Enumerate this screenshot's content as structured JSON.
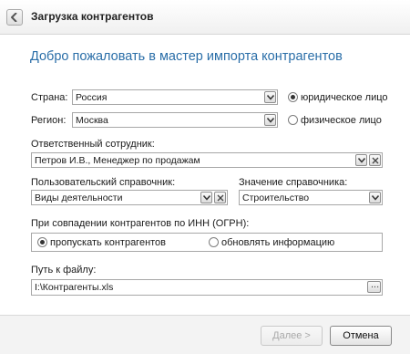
{
  "header": {
    "title": "Загрузка контрагентов",
    "back_icon": "chevron-left-icon"
  },
  "welcome": "Добро пожаловать в мастер импорта контрагентов",
  "country": {
    "label": "Страна:",
    "value": "Россия"
  },
  "region": {
    "label": "Регион:",
    "value": "Москва"
  },
  "entity_type": {
    "legal": "юридическое лицо",
    "individual": "физическое лицо",
    "selected": "legal"
  },
  "responsible": {
    "label": "Ответственный сотрудник:",
    "value": "Петров И.В., Менеджер по продажам"
  },
  "user_directory": {
    "label": "Пользовательский справочник:",
    "value": "Виды деятельности"
  },
  "directory_value": {
    "label": "Значение справочника:",
    "value": "Строительство"
  },
  "inn_match": {
    "label": "При совпадении контрагентов по ИНН (ОГРН):",
    "skip": "пропускать контрагентов",
    "update": "обновлять информацию",
    "selected": "skip"
  },
  "file_path": {
    "label": "Путь к файлу:",
    "value": "I:\\Контрагенты.xls",
    "browse": "..."
  },
  "footer": {
    "next": "Далее >",
    "cancel": "Отмена"
  },
  "colors": {
    "accent": "#2a6ea8"
  }
}
